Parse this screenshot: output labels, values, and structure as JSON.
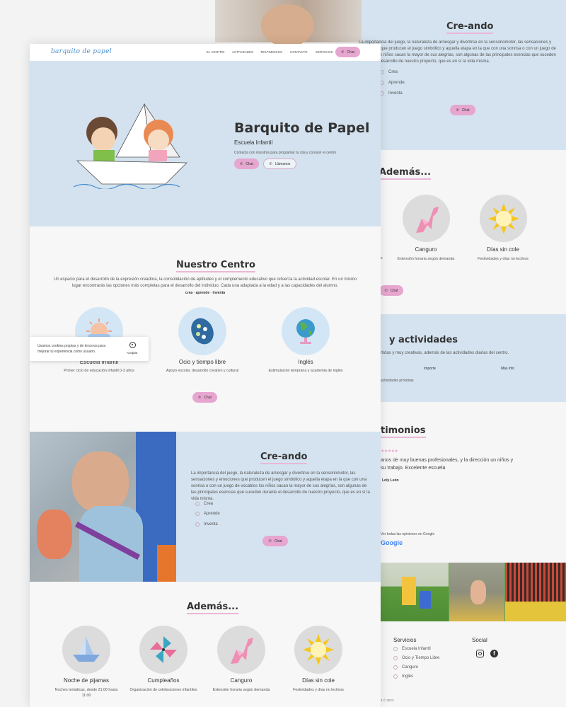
{
  "back": {
    "creando": {
      "title": "Cre-ando",
      "text": "La importancia del juego, la naturaleza de arriesgar y divertirse en la sensoriomotor, las sensaciones y emociones que producen el juego simbólico y aquella etapa en la que con una sonrisa o con un juego de vocablos los niños sacan la mayor de sus alegrías, son algunas de las principales esencias que suceden durante el desarrollo de nuestro proyecto, que es en sí la vida misma.",
      "checks": [
        "Crea",
        "Aprende",
        "Inventa"
      ],
      "chat": "Chat"
    },
    "ademas_title": "Además...",
    "cards": [
      {
        "title": "Canguro",
        "sub": "Extensión horaria según demanda"
      },
      {
        "title": "Días sin cole",
        "sub": "Festividades y días no lectivos"
      }
    ],
    "cut_letter": "s",
    "chat2": "Chat",
    "actividades": {
      "title": "y actividades",
      "text": "rtidas y muy creativas, además de las actividades diarias del centro.",
      "col1": "Importe",
      "col2": "Más info",
      "note": "actividades próximas"
    },
    "testimonios": {
      "title": "timonios",
      "stars": "★★★★★",
      "quote": "anos de muy buenas profesionales, y la dirección un niños y su trabajo. Excelente escuela",
      "author": "Loly León",
      "google_note": "Ver todas las opiniones en Google",
      "google": "Google"
    },
    "footer": {
      "servicios_title": "Servicios",
      "servicios": [
        "Escuela Infantil",
        "Ocio y Tiempo Libre",
        "Canguro",
        "Inglés"
      ],
      "social_title": "Social",
      "copy": "4 © 2023"
    }
  },
  "front": {
    "nav": {
      "logo": "barquito de papel",
      "items": [
        "EL CENTRO",
        "ACTIVIDADES",
        "TESTIMONIOS",
        "CONTACTO",
        "SERVICIOS"
      ],
      "chat": "Chat"
    },
    "hero": {
      "title": "Barquito de Papel",
      "subtitle": "Escuela Infantil",
      "text": "Contacta con nosotros para programar tu cita y conocer el centro",
      "chat": "Chat",
      "call": "Llámanos"
    },
    "centro": {
      "title": "Nuestro Centro",
      "text": "Un espacio para el desarrollo de la expresión creadora, la consolidación de aptitudes y el complemento educativo que refuerza la actividad escolar. En un mismo lugar encontrarás las opciones más completas para el desarrollo del individuo. Cada una adaptada a la edad y a las capacidades del alumno.",
      "motto": "crea · aprende · inventa",
      "cards": [
        {
          "title": "Escuela Infantil",
          "sub": "Primer ciclo de educación infantil 0-3 años"
        },
        {
          "title": "Ocio y tiempo libre",
          "sub": "Apoyo escolar, desarrollo creativo y cultural"
        },
        {
          "title": "Inglés",
          "sub": "Estimulación temprana y academia de inglés"
        }
      ],
      "chat": "Chat"
    },
    "cookie": {
      "text": "Usamos cookies propias y de terceros para mejorar tu experiencia como usuario.",
      "accept": "Aceptar"
    },
    "creando": {
      "title": "Cre-ando",
      "text": "La importancia del juego, la naturaleza de arriesgar y divertirse en la sensoriomotor, las sensaciones y emociones que producen el juego simbólico y aquella etapa en la que con una sonrisa o con un juego de vocablos los niños sacan la mayor de sus alegrías, son algunas de las principales esencias que suceden durante el desarrollo de nuestro proyecto, que es en sí la vida misma.",
      "checks": [
        "Crea",
        "Aprende",
        "Inventa"
      ],
      "chat": "Chat"
    },
    "ademas": {
      "title": "Además...",
      "cards": [
        {
          "title": "Noche de pijamas",
          "sub": "Noches temáticas, desde 21:00 hasta 11:00"
        },
        {
          "title": "Cumpleaños",
          "sub": "Organización de celebraciones infantiles"
        },
        {
          "title": "Canguro",
          "sub": "Extensión horaria según demanda"
        },
        {
          "title": "Días sin cole",
          "sub": "Festividades y días no lectivos"
        }
      ]
    }
  },
  "colors": {
    "accent_pink": "#e7a6cf",
    "hero_blue": "#d3e2ee",
    "logo_blue": "#4a8fcf"
  }
}
